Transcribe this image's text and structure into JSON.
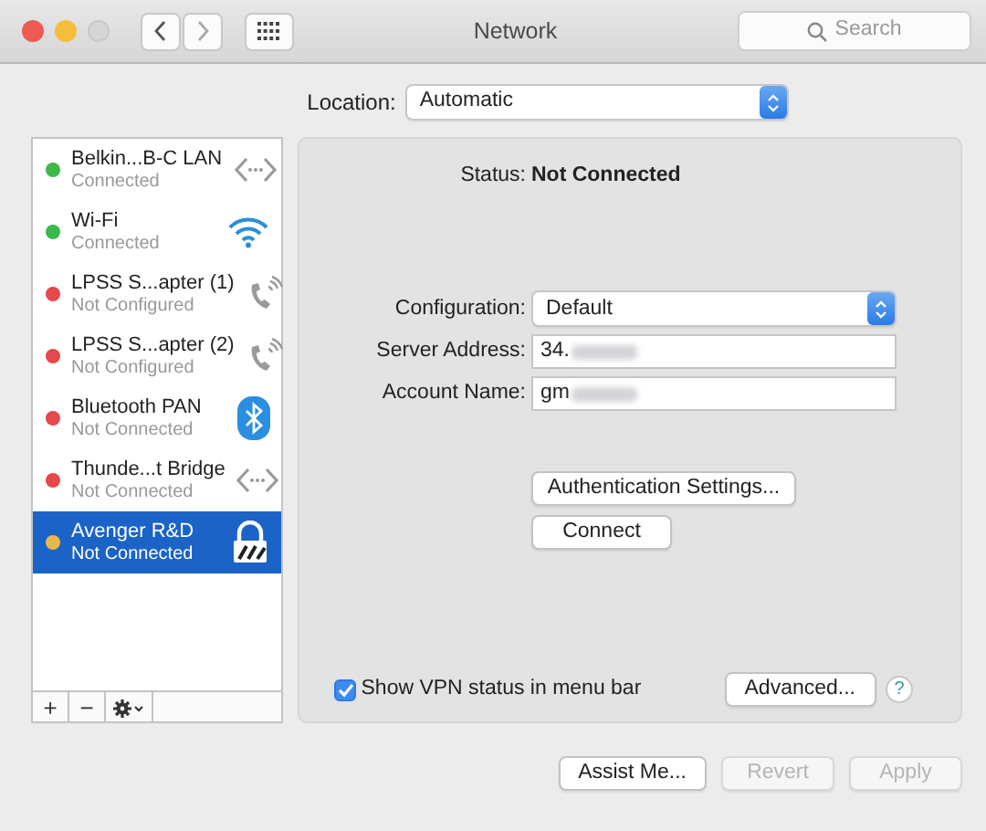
{
  "window": {
    "title": "Network",
    "search": {
      "placeholder": "Search"
    }
  },
  "location": {
    "label": "Location:",
    "value": "Automatic"
  },
  "services": [
    {
      "name": "Belkin...B-C LAN",
      "status": "Connected",
      "color": "#3cb94a",
      "kind": "ethernet",
      "selected": false
    },
    {
      "name": "Wi-Fi",
      "status": "Connected",
      "color": "#3cb94a",
      "kind": "wifi",
      "selected": false
    },
    {
      "name": "LPSS S...apter (1)",
      "status": "Not Configured",
      "color": "#e5484d",
      "kind": "phone",
      "selected": false
    },
    {
      "name": "LPSS S...apter (2)",
      "status": "Not Configured",
      "color": "#e5484d",
      "kind": "phone",
      "selected": false
    },
    {
      "name": "Bluetooth PAN",
      "status": "Not Connected",
      "color": "#e5484d",
      "kind": "bluetooth",
      "selected": false
    },
    {
      "name": "Thunde...t Bridge",
      "status": "Not Connected",
      "color": "#e5484d",
      "kind": "ethernet",
      "selected": false
    },
    {
      "name": "Avenger R&D",
      "status": "Not Connected",
      "color": "#e8b94a",
      "kind": "vpn",
      "selected": true
    }
  ],
  "list_tools": [
    "+",
    "−"
  ],
  "status": {
    "label": "Status:",
    "value": "Not Connected"
  },
  "form": [
    {
      "kind": "select",
      "label": "Configuration:",
      "value": "Default"
    },
    {
      "kind": "text",
      "label": "Server Address:",
      "value": "34."
    },
    {
      "kind": "text",
      "label": "Account Name:",
      "value": "gm"
    }
  ],
  "auth_button": "Authentication Settings...",
  "connect_button": "Connect",
  "vpn_status_checkbox": {
    "label": "Show VPN status in menu bar",
    "checked": true
  },
  "advanced_button": "Advanced...",
  "help_button": "?",
  "footer_buttons": [
    {
      "label": "Assist Me...",
      "disabled": false
    },
    {
      "label": "Revert",
      "disabled": true
    },
    {
      "label": "Apply",
      "disabled": true
    }
  ]
}
